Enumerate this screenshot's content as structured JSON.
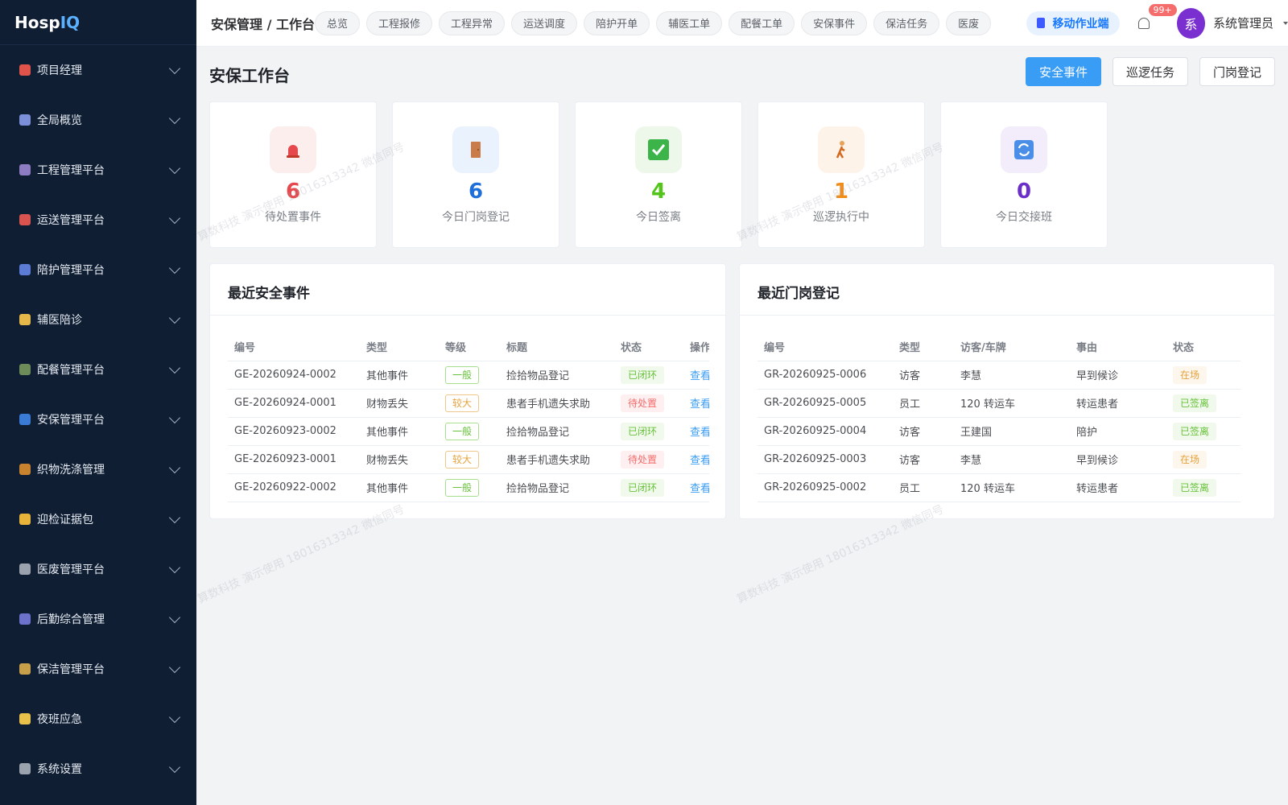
{
  "app": {
    "logo_a": "Hosp",
    "logo_b": "IQ"
  },
  "sidebar": {
    "items": [
      {
        "label": "项目经理",
        "icon": "target-icon",
        "color": "#e0534a"
      },
      {
        "label": "全局概览",
        "icon": "chart-icon",
        "color": "#7a8fd8"
      },
      {
        "label": "工程管理平台",
        "icon": "building-icon",
        "color": "#8e7cc3"
      },
      {
        "label": "运送管理平台",
        "icon": "truck-icon",
        "color": "#d9534f"
      },
      {
        "label": "陪护管理平台",
        "icon": "bed-icon",
        "color": "#5b7bd5"
      },
      {
        "label": "辅医陪诊",
        "icon": "heart-icon",
        "color": "#e6b84a"
      },
      {
        "label": "配餐管理平台",
        "icon": "food-icon",
        "color": "#6d8c5a"
      },
      {
        "label": "安保管理平台",
        "icon": "shield-icon",
        "color": "#3a7bd5"
      },
      {
        "label": "织物洗涤管理",
        "icon": "basket-icon",
        "color": "#c9822e"
      },
      {
        "label": "迎检证据包",
        "icon": "folder-icon",
        "color": "#e8b339"
      },
      {
        "label": "医废管理平台",
        "icon": "trash-icon",
        "color": "#9aa3ad"
      },
      {
        "label": "后勤综合管理",
        "icon": "people-icon",
        "color": "#6c72c9"
      },
      {
        "label": "保洁管理平台",
        "icon": "broom-icon",
        "color": "#c9a04a"
      },
      {
        "label": "夜班应急",
        "icon": "moon-icon",
        "color": "#e8c04a"
      },
      {
        "label": "系统设置",
        "icon": "gear-icon",
        "color": "#9aa3ad"
      }
    ]
  },
  "header": {
    "breadcrumb": "安保管理 / 工作台",
    "tabs": [
      "总览",
      "工程报修",
      "工程异常",
      "运送调度",
      "陪护开单",
      "辅医工单",
      "配餐工单",
      "安保事件",
      "保洁任务",
      "医废"
    ],
    "active_tab": "移动作业端",
    "notification_count": "99+",
    "avatar_char": "系",
    "user_name": "系统管理员"
  },
  "page": {
    "title": "安保工作台",
    "buttons": {
      "primary": "安全事件",
      "patrol": "巡逻任务",
      "gate": "门岗登记"
    }
  },
  "stats": [
    {
      "value": "6",
      "label": "待处置事件",
      "color": "#e5484d",
      "bg": "#fdeeee",
      "icon": "alarm-icon"
    },
    {
      "value": "6",
      "label": "今日门岗登记",
      "color": "#1e6fd9",
      "bg": "#eaf2fd",
      "icon": "door-icon"
    },
    {
      "value": "4",
      "label": "今日签离",
      "color": "#52c41a",
      "bg": "#edf8ea",
      "icon": "check-icon"
    },
    {
      "value": "1",
      "label": "巡逻执行中",
      "color": "#f08c1a",
      "bg": "#fef3e8",
      "icon": "walk-icon"
    },
    {
      "value": "0",
      "label": "今日交接班",
      "color": "#6b2fc9",
      "bg": "#f2ecfb",
      "icon": "sync-icon"
    }
  ],
  "events": {
    "title": "最近安全事件",
    "headers": [
      "编号",
      "类型",
      "等级",
      "标题",
      "状态",
      "操作"
    ],
    "rows": [
      {
        "id": "GE-20260924-0002",
        "type": "其他事件",
        "level": "一般",
        "title": "捡拾物品登记",
        "status": "已闭环",
        "action": "查看"
      },
      {
        "id": "GE-20260924-0001",
        "type": "财物丢失",
        "level": "较大",
        "title": "患者手机遗失求助",
        "status": "待处置",
        "action": "查看"
      },
      {
        "id": "GE-20260923-0002",
        "type": "其他事件",
        "level": "一般",
        "title": "捡拾物品登记",
        "status": "已闭环",
        "action": "查看"
      },
      {
        "id": "GE-20260923-0001",
        "type": "财物丢失",
        "level": "较大",
        "title": "患者手机遗失求助",
        "status": "待处置",
        "action": "查看"
      },
      {
        "id": "GE-20260922-0002",
        "type": "其他事件",
        "level": "一般",
        "title": "捡拾物品登记",
        "status": "已闭环",
        "action": "查看"
      }
    ]
  },
  "gate": {
    "title": "最近门岗登记",
    "headers": [
      "编号",
      "类型",
      "访客/车牌",
      "事由",
      "状态"
    ],
    "rows": [
      {
        "id": "GR-20260925-0006",
        "type": "访客",
        "visitor": "李慧",
        "reason": "早到候诊",
        "status": "在场"
      },
      {
        "id": "GR-20260925-0005",
        "type": "员工",
        "visitor": "120 转运车",
        "reason": "转运患者",
        "status": "已签离"
      },
      {
        "id": "GR-20260925-0004",
        "type": "访客",
        "visitor": "王建国",
        "reason": "陪护",
        "status": "已签离"
      },
      {
        "id": "GR-20260925-0003",
        "type": "访客",
        "visitor": "李慧",
        "reason": "早到候诊",
        "status": "在场"
      },
      {
        "id": "GR-20260925-0002",
        "type": "员工",
        "visitor": "120 转运车",
        "reason": "转运患者",
        "status": "已签离"
      }
    ]
  },
  "watermark": "算数科技 演示使用 18016313342 微信同号"
}
